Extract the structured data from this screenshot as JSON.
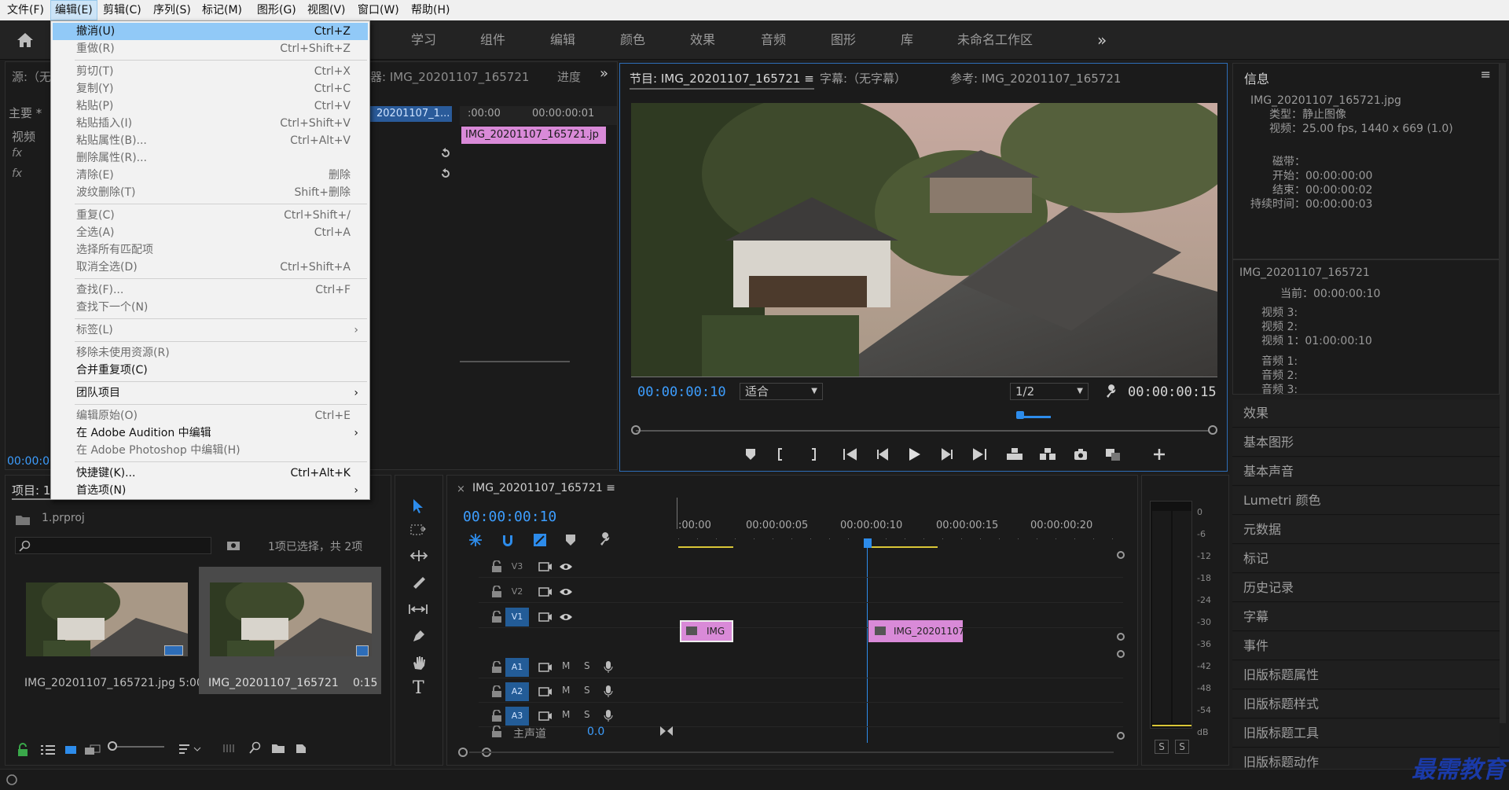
{
  "menubar": {
    "items": [
      "文件(F)",
      "编辑(E)",
      "剪辑(C)",
      "序列(S)",
      "标记(M)",
      "图形(G)",
      "视图(V)",
      "窗口(W)",
      "帮助(H)"
    ],
    "active_index": 1
  },
  "workspace_tabs": [
    "学习",
    "组件",
    "编辑",
    "颜色",
    "效果",
    "音频",
    "图形",
    "库",
    "未命名工作区"
  ],
  "workspace_more": "»",
  "edit_menu": [
    {
      "label": "撤消(U)",
      "shortcut": "Ctrl+Z",
      "state": "highlight"
    },
    {
      "label": "重做(R)",
      "shortcut": "Ctrl+Shift+Z",
      "state": "disabled"
    },
    {
      "sep": true
    },
    {
      "label": "剪切(T)",
      "shortcut": "Ctrl+X",
      "state": "disabled"
    },
    {
      "label": "复制(Y)",
      "shortcut": "Ctrl+C",
      "state": "disabled"
    },
    {
      "label": "粘贴(P)",
      "shortcut": "Ctrl+V",
      "state": "disabled"
    },
    {
      "label": "粘贴插入(I)",
      "shortcut": "Ctrl+Shift+V",
      "state": "disabled"
    },
    {
      "label": "粘贴属性(B)...",
      "shortcut": "Ctrl+Alt+V",
      "state": "disabled"
    },
    {
      "label": "删除属性(R)...",
      "shortcut": "",
      "state": "disabled"
    },
    {
      "label": "清除(E)",
      "shortcut": "删除",
      "state": "disabled"
    },
    {
      "label": "波纹删除(T)",
      "shortcut": "Shift+删除",
      "state": "disabled"
    },
    {
      "sep": true
    },
    {
      "label": "重复(C)",
      "shortcut": "Ctrl+Shift+/",
      "state": "disabled"
    },
    {
      "label": "全选(A)",
      "shortcut": "Ctrl+A",
      "state": "disabled"
    },
    {
      "label": "选择所有匹配项",
      "shortcut": "",
      "state": "disabled"
    },
    {
      "label": "取消全选(D)",
      "shortcut": "Ctrl+Shift+A",
      "state": "disabled"
    },
    {
      "sep": true
    },
    {
      "label": "查找(F)...",
      "shortcut": "Ctrl+F",
      "state": "disabled"
    },
    {
      "label": "查找下一个(N)",
      "shortcut": "",
      "state": "disabled"
    },
    {
      "sep": true
    },
    {
      "label": "标签(L)",
      "shortcut": "",
      "state": "disabled",
      "submenu": true
    },
    {
      "sep": true
    },
    {
      "label": "移除未使用资源(R)",
      "shortcut": "",
      "state": "disabled"
    },
    {
      "label": "合并重复项(C)",
      "shortcut": "",
      "state": "normal"
    },
    {
      "sep": true
    },
    {
      "label": "团队项目",
      "shortcut": "",
      "state": "normal",
      "submenu": true
    },
    {
      "sep": true
    },
    {
      "label": "编辑原始(O)",
      "shortcut": "Ctrl+E",
      "state": "disabled"
    },
    {
      "label": "在 Adobe Audition 中编辑",
      "shortcut": "",
      "state": "normal",
      "submenu": true
    },
    {
      "label": "在 Adobe Photoshop 中编辑(H)",
      "shortcut": "",
      "state": "disabled"
    },
    {
      "sep": true
    },
    {
      "label": "快捷键(K)...",
      "shortcut": "Ctrl+Alt+K",
      "state": "normal"
    },
    {
      "label": "首选项(N)",
      "shortcut": "",
      "state": "normal",
      "submenu": true
    }
  ],
  "source_panel": {
    "title_prefix": "源:（无",
    "mixer_title": "器: IMG_20201107_165721",
    "more_tab": "进度",
    "master_label": "主要 *",
    "clip_tag": "20201107_1...",
    "video_label": "视频",
    "fx_rows": [
      "fx",
      "fx",
      ""
    ],
    "ruler_labels": [
      ":00:00",
      "00:00:00:01"
    ],
    "clip_name": "IMG_20201107_165721.jp",
    "timecode": "00:00:00"
  },
  "program_monitor": {
    "tab_program": "节目: IMG_20201107_165721",
    "tab_caption": "字幕:（无字幕）",
    "tab_reference": "参考: IMG_20201107_165721",
    "timecode": "00:00:00:10",
    "fit_label": "适合",
    "resolution_label": "1/2",
    "duration": "00:00:00:15"
  },
  "info_panel": {
    "title": "信息",
    "file_name": "IMG_20201107_165721.jpg",
    "type_line": "类型：静止图像",
    "video_line": "视频：25.00 fps, 1440 x 669 (1.0)",
    "tape_label": "磁带：",
    "start_line": "开始：00:00:00:00",
    "end_line": "结束：00:00:00:02",
    "duration_line": "持续时间：00:00:00:03",
    "seq_name": "IMG_20201107_165721",
    "current_line": "当前：00:00:00:10",
    "video_tracks": [
      "视频 3:",
      "视频 2:",
      "视频 1：01:00:00:10"
    ],
    "audio_tracks": [
      "音频 1:",
      "音频 2:",
      "音频 3:"
    ]
  },
  "right_panels": [
    "效果",
    "基本图形",
    "基本声音",
    "Lumetri 颜色",
    "元数据",
    "标记",
    "历史记录",
    "字幕",
    "事件",
    "旧版标题属性",
    "旧版标题样式",
    "旧版标题工具",
    "旧版标题动作"
  ],
  "project_panel": {
    "tab": "项目: 1",
    "project_file": "1.prproj",
    "selection_info": "1项已选择，共 2项",
    "items": [
      {
        "name": "IMG_20201107_165721.jpg",
        "duration": "5:00"
      },
      {
        "name": "IMG_20201107_165721",
        "duration": "0:15"
      }
    ]
  },
  "timeline": {
    "sequence_tab": "IMG_20201107_165721",
    "timecode": "00:00:00:10",
    "ruler": [
      ":00:00",
      "00:00:00:05",
      "00:00:00:10",
      "00:00:00:15",
      "00:00:00:20"
    ],
    "video_tracks": [
      "V3",
      "V2",
      "V1"
    ],
    "audio_tracks": [
      "A1",
      "A2",
      "A3"
    ],
    "mute_label": "M",
    "solo_label": "S",
    "master_label": "主声道",
    "master_value": "0.0",
    "clip1": "IMG",
    "clip2": "IMG_20201107",
    "meter_scale": [
      "0",
      "-6",
      "-12",
      "-18",
      "-24",
      "-30",
      "-36",
      "-42",
      "-48",
      "-54",
      "dB"
    ],
    "meter_buttons": [
      "S",
      "S"
    ]
  },
  "watermark": "最需教育",
  "colors": {
    "accent_blue": "#2d8ceb",
    "clip_pink": "#d98ad8",
    "menu_highlight": "#91c9f7"
  }
}
